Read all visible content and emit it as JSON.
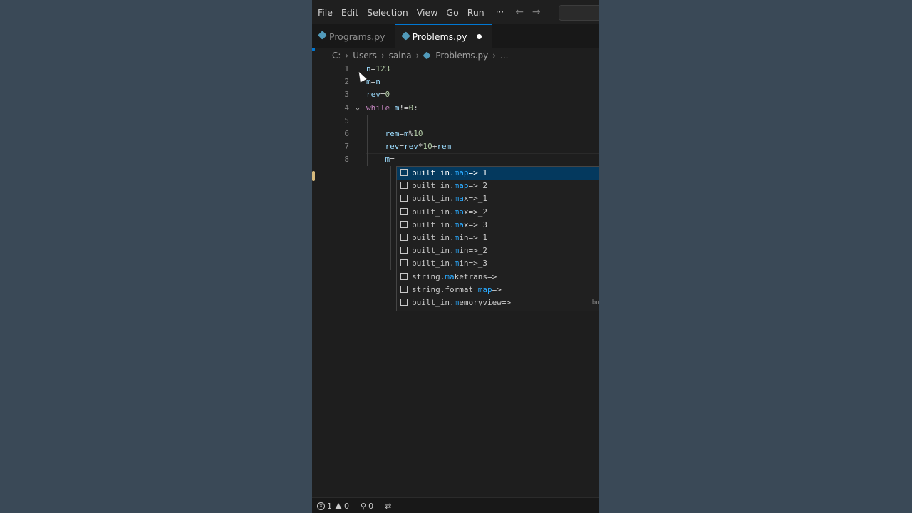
{
  "menu": {
    "items": [
      "File",
      "Edit",
      "Selection",
      "View",
      "Go",
      "Run"
    ],
    "more": "···"
  },
  "tabs": [
    {
      "label": "Programs.py",
      "active": false,
      "dirty": false
    },
    {
      "label": "Problems.py",
      "active": true,
      "dirty": true
    }
  ],
  "breadcrumb": {
    "segments": [
      "C:",
      "Users",
      "saina",
      "Problems.py",
      "..."
    ]
  },
  "code_lines": [
    {
      "num": "1",
      "tokens": [
        [
          "v",
          "n"
        ],
        [
          "o",
          "="
        ],
        [
          "n",
          "123"
        ]
      ]
    },
    {
      "num": "2",
      "tokens": [
        [
          "v",
          "m"
        ],
        [
          "o",
          "="
        ],
        [
          "v",
          "n"
        ]
      ]
    },
    {
      "num": "3",
      "tokens": [
        [
          "v",
          "rev"
        ],
        [
          "o",
          "="
        ],
        [
          "n",
          "0"
        ]
      ]
    },
    {
      "num": "4",
      "tokens": [
        [
          "k",
          "while"
        ],
        [
          "o",
          " "
        ],
        [
          "v",
          "m"
        ],
        [
          "o",
          "!="
        ],
        [
          "n",
          "0"
        ],
        [
          "o",
          ":"
        ]
      ]
    },
    {
      "num": "5",
      "tokens": []
    },
    {
      "num": "6",
      "tokens": [
        [
          "o",
          "    "
        ],
        [
          "v",
          "rem"
        ],
        [
          "o",
          "="
        ],
        [
          "v",
          "m"
        ],
        [
          "o",
          "%"
        ],
        [
          "n",
          "10"
        ]
      ]
    },
    {
      "num": "7",
      "tokens": [
        [
          "o",
          "    "
        ],
        [
          "v",
          "rev"
        ],
        [
          "o",
          "="
        ],
        [
          "v",
          "rev"
        ],
        [
          "o",
          "*"
        ],
        [
          "n",
          "10"
        ],
        [
          "o",
          "+"
        ],
        [
          "v",
          "rem"
        ]
      ]
    },
    {
      "num": "8",
      "tokens": [
        [
          "o",
          "    "
        ],
        [
          "v",
          "m"
        ],
        [
          "o",
          "="
        ]
      ]
    }
  ],
  "suggestions": [
    {
      "pre": "built_in.",
      "hl": "map",
      "post": "=>_1",
      "detail": "",
      "selected": true
    },
    {
      "pre": "built_in.",
      "hl": "map",
      "post": "=>_2",
      "detail": "",
      "selected": false
    },
    {
      "pre": "built_in.",
      "hl": "ma",
      "post": "x=>_1",
      "detail": "",
      "selected": false
    },
    {
      "pre": "built_in.",
      "hl": "ma",
      "post": "x=>_2",
      "detail": "",
      "selected": false
    },
    {
      "pre": "built_in.",
      "hl": "ma",
      "post": "x=>_3",
      "detail": "",
      "selected": false
    },
    {
      "pre": "built_in.",
      "hl": "m",
      "post": "in=>_1",
      "detail": "",
      "selected": false
    },
    {
      "pre": "built_in.",
      "hl": "m",
      "post": "in=>_2",
      "detail": "",
      "selected": false
    },
    {
      "pre": "built_in.",
      "hl": "m",
      "post": "in=>_3",
      "detail": "",
      "selected": false
    },
    {
      "pre": "string.",
      "hl": "ma",
      "post": "ketrans=>",
      "detail": "",
      "selected": false
    },
    {
      "pre": "string.format_",
      "hl": "map",
      "post": "=>",
      "detail": "s",
      "selected": false
    },
    {
      "pre": "built_in.",
      "hl": "m",
      "post": "emoryview=>",
      "detail": "bui",
      "selected": false
    }
  ],
  "status": {
    "errors": "1",
    "warnings": "0",
    "ports": "0"
  },
  "colors": {
    "accent": "#0078d4",
    "selection": "#04395e",
    "match_highlight": "#2aaaff"
  }
}
